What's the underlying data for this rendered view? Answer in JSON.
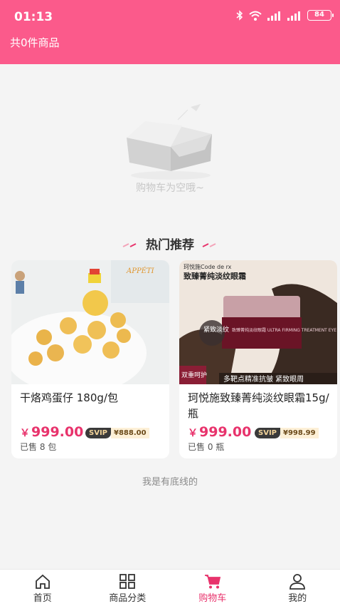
{
  "status_bar": {
    "time": "01:13",
    "battery": "84"
  },
  "header": {
    "cart_count_text": "共0件商品"
  },
  "empty": {
    "text": "购物车为空哦~"
  },
  "hot": {
    "title": "热门推荐"
  },
  "products": [
    {
      "name": "干烙鸡蛋仔 180g/包",
      "price_symbol": "￥",
      "price": "999.00",
      "svip_label": "SVIP",
      "svip_price": "¥888.00",
      "sold": "已售 8 包",
      "image_text": "APPÉTI"
    },
    {
      "name": "珂悦施致臻菁纯淡纹眼霜15g/瓶",
      "price_symbol": "￥",
      "price": "999.00",
      "svip_label": "SVIP",
      "svip_price": "¥998.99",
      "sold": "已售 0 瓶",
      "img_brand": "珂悦施Code de rx",
      "img_title": "致臻菁纯淡纹眼霜",
      "img_badge": "紧致淡纹",
      "img_jar_text": "致臻菁纯淡纹眼霜 ULTRA FIRMING TREATMENT EYE CREAM",
      "img_corner": "双重呵护",
      "img_banner": "多靶点精准抗皱 紧致眼周"
    }
  ],
  "footer": {
    "text": "我是有底线的"
  },
  "tabs": [
    {
      "label": "首页",
      "icon": "home-icon"
    },
    {
      "label": "商品分类",
      "icon": "grid-icon"
    },
    {
      "label": "购物车",
      "icon": "cart-icon",
      "active": true
    },
    {
      "label": "我的",
      "icon": "user-icon"
    }
  ],
  "colors": {
    "brand": "#fb5a8b",
    "accent": "#e8336c"
  }
}
